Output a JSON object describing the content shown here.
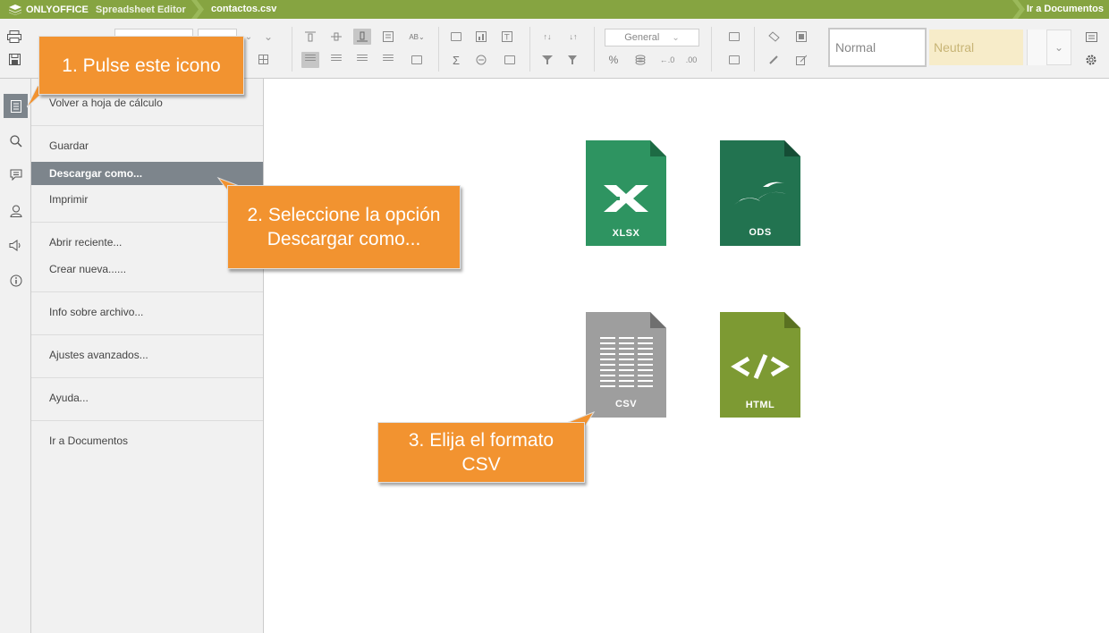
{
  "titlebar": {
    "brand": "ONLYOFFICE",
    "product": "Spreadsheet Editor",
    "document": "contactos.csv",
    "goto_label": "Ir a Documentos",
    "bg_color": "#86a441"
  },
  "toolbar": {
    "number_format": "General",
    "style_normal": "Normal",
    "style_neutral": "Neutral"
  },
  "leftbar": {
    "items": [
      {
        "icon": "file-icon",
        "active": true
      },
      {
        "icon": "search-icon"
      },
      {
        "icon": "comments-icon"
      },
      {
        "icon": "user-icon"
      },
      {
        "icon": "feedback-icon"
      },
      {
        "icon": "info-icon"
      }
    ]
  },
  "file_menu": {
    "items": [
      {
        "label": "Volver a hoja de cálculo"
      },
      {
        "label": "Guardar"
      },
      {
        "label": "Descargar como...",
        "selected": true
      },
      {
        "label": "Imprimir"
      },
      {
        "label": "Abrir reciente..."
      },
      {
        "label": "Crear nueva......"
      },
      {
        "label": "Info sobre archivo..."
      },
      {
        "label": "Ajustes avanzados..."
      },
      {
        "label": "Ayuda..."
      },
      {
        "label": "Ir a Documentos"
      }
    ]
  },
  "formats": [
    {
      "label": "XLSX",
      "color": "#2e9461"
    },
    {
      "label": "ODS",
      "color": "#227350"
    },
    {
      "label": "CSV",
      "color": "#9e9e9e"
    },
    {
      "label": "HTML",
      "color": "#7d9a33"
    }
  ],
  "callouts": {
    "step1": "1. Pulse este icono",
    "step2_line1": "2. Seleccione la opción",
    "step2_line2": "Descargar como...",
    "step3_line1": "3. Elija el formato",
    "step3_line2": "CSV",
    "color": "#f29330"
  }
}
